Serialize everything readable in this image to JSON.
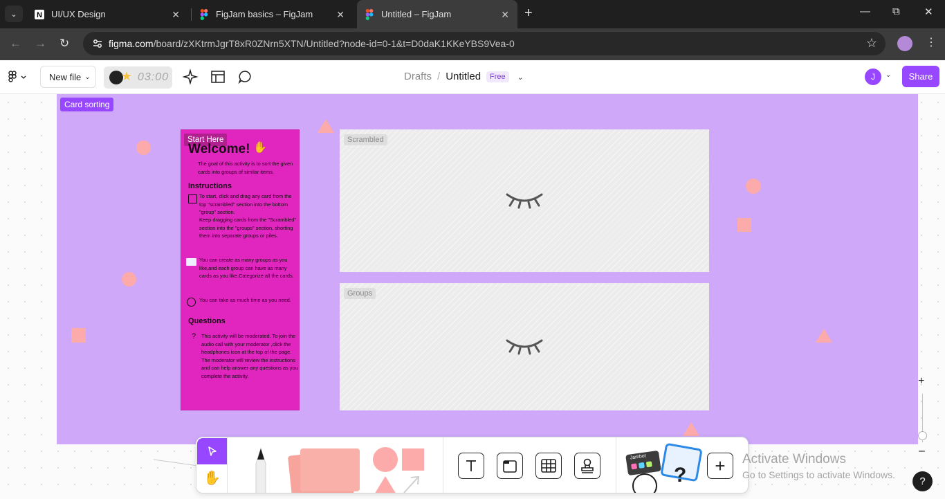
{
  "browser": {
    "tabs": [
      {
        "title": "UI/UX Design",
        "icon": "notion-favicon-icon",
        "active": false
      },
      {
        "title": "FigJam basics – FigJam",
        "icon": "figma-favicon-icon",
        "active": false
      },
      {
        "title": "Untitled – FigJam",
        "icon": "figma-favicon-icon",
        "active": true
      }
    ],
    "url_host": "figma.com",
    "url_path": "/board/zXKtrmJgrT8xR0ZNrn5XTN/Untitled?node-id=0-1&t=D0daK1KKeYBS9Vea-0"
  },
  "header": {
    "new_file_label": "New file",
    "timer": "03:00",
    "breadcrumb_drafts": "Drafts",
    "breadcrumb_separator": "/",
    "file_name": "Untitled",
    "plan_badge": "Free",
    "avatar_initial": "J",
    "share_label": "Share"
  },
  "board": {
    "section_label": "Card sorting",
    "card": {
      "badge": "Start Here",
      "title": "Welcome!",
      "intro": "The goal of this activity is to sort the given cards into groups of similar items.",
      "instructions_heading": "Instructions",
      "instruction_1": "To start, click and drag any card from the top \"scrambled\" section into the bottom \"group\" section.",
      "instruction_2": "Keep dragging cards from the \"Scrambled\" section into the \"groups\" section, shorting them into separate groups or piles.",
      "instruction_3": "You can create as many groups as you like,and each group can have as many cards as you like.Categorize all the cards.",
      "instruction_4": "You can take as much time as you need.",
      "questions_heading": "Questions",
      "questions_text": "This activity will be moderated. To join the audio call with your moderator ,click the headphones icon at the top of the page. The moderator will review the instructions and can help answer any questions as you complete the activity."
    },
    "scrambled_label": "Scrambled",
    "groups_label": "Groups"
  },
  "toolbar": {
    "tools": [
      "select-tool",
      "hand-tool",
      "marker-tool",
      "sticky-note-tool",
      "shapes-tool",
      "text-tool",
      "section-tool",
      "table-tool",
      "stamp-tool",
      "widgets-tool",
      "more-tool"
    ],
    "sticker_text": "Jambot"
  },
  "overlay": {
    "activate_title": "Activate Windows",
    "activate_subtitle": "Go to Settings to activate Windows."
  },
  "colors": {
    "accent": "#9747ff",
    "section_fill": "#cfa8fa",
    "card_fill": "#e026be",
    "shape_fill": "#fcaaaa"
  }
}
